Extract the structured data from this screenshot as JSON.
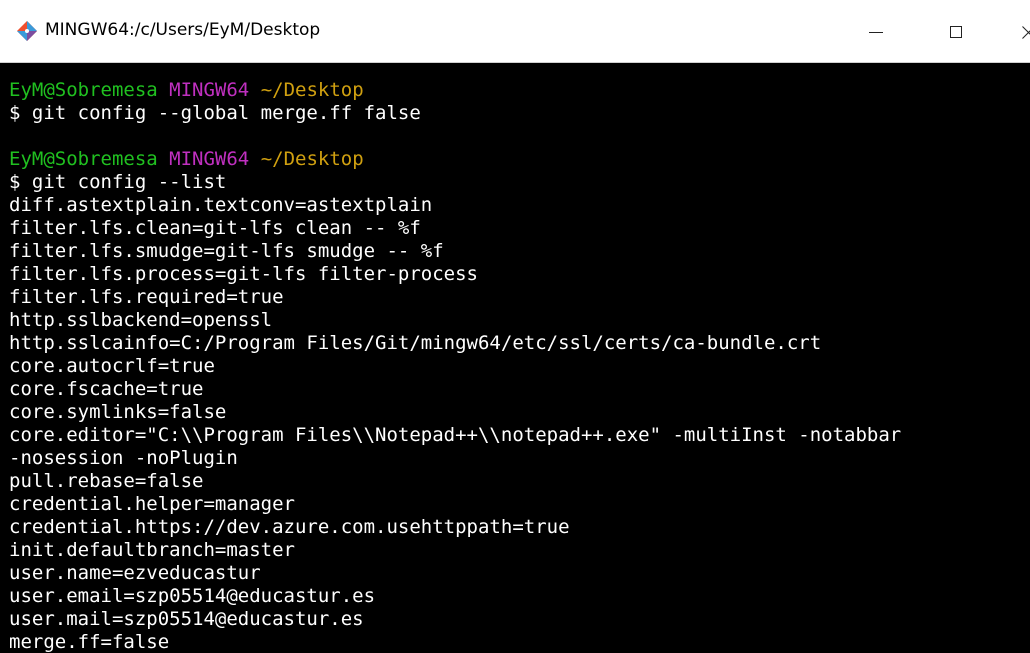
{
  "window": {
    "title": "MINGW64:/c/Users/EyM/Desktop",
    "icon": "git-bash-icon",
    "colors": {
      "background": "#000000",
      "prompt_user": "#20c020",
      "prompt_system": "#c030c0",
      "prompt_dir": "#d0a010",
      "text": "#ffffff"
    }
  },
  "terminal": {
    "block1": {
      "user": "EyM@Sobremesa",
      "system": "MINGW64",
      "dir": "~/Desktop",
      "command": "$ git config --global merge.ff false"
    },
    "block2": {
      "user": "EyM@Sobremesa",
      "system": "MINGW64",
      "dir": "~/Desktop",
      "command": "$ git config --list"
    },
    "output": [
      "diff.astextplain.textconv=astextplain",
      "filter.lfs.clean=git-lfs clean -- %f",
      "filter.lfs.smudge=git-lfs smudge -- %f",
      "filter.lfs.process=git-lfs filter-process",
      "filter.lfs.required=true",
      "http.sslbackend=openssl",
      "http.sslcainfo=C:/Program Files/Git/mingw64/etc/ssl/certs/ca-bundle.crt",
      "core.autocrlf=true",
      "core.fscache=true",
      "core.symlinks=false",
      "core.editor=\"C:\\\\Program Files\\\\Notepad++\\\\notepad++.exe\" -multiInst -notabbar",
      "-nosession -noPlugin",
      "pull.rebase=false",
      "credential.helper=manager",
      "credential.https://dev.azure.com.usehttppath=true",
      "init.defaultbranch=master",
      "user.name=ezveducastur",
      "user.email=szp05514@educastur.es",
      "user.mail=szp05514@educastur.es",
      "merge.ff=false"
    ]
  }
}
